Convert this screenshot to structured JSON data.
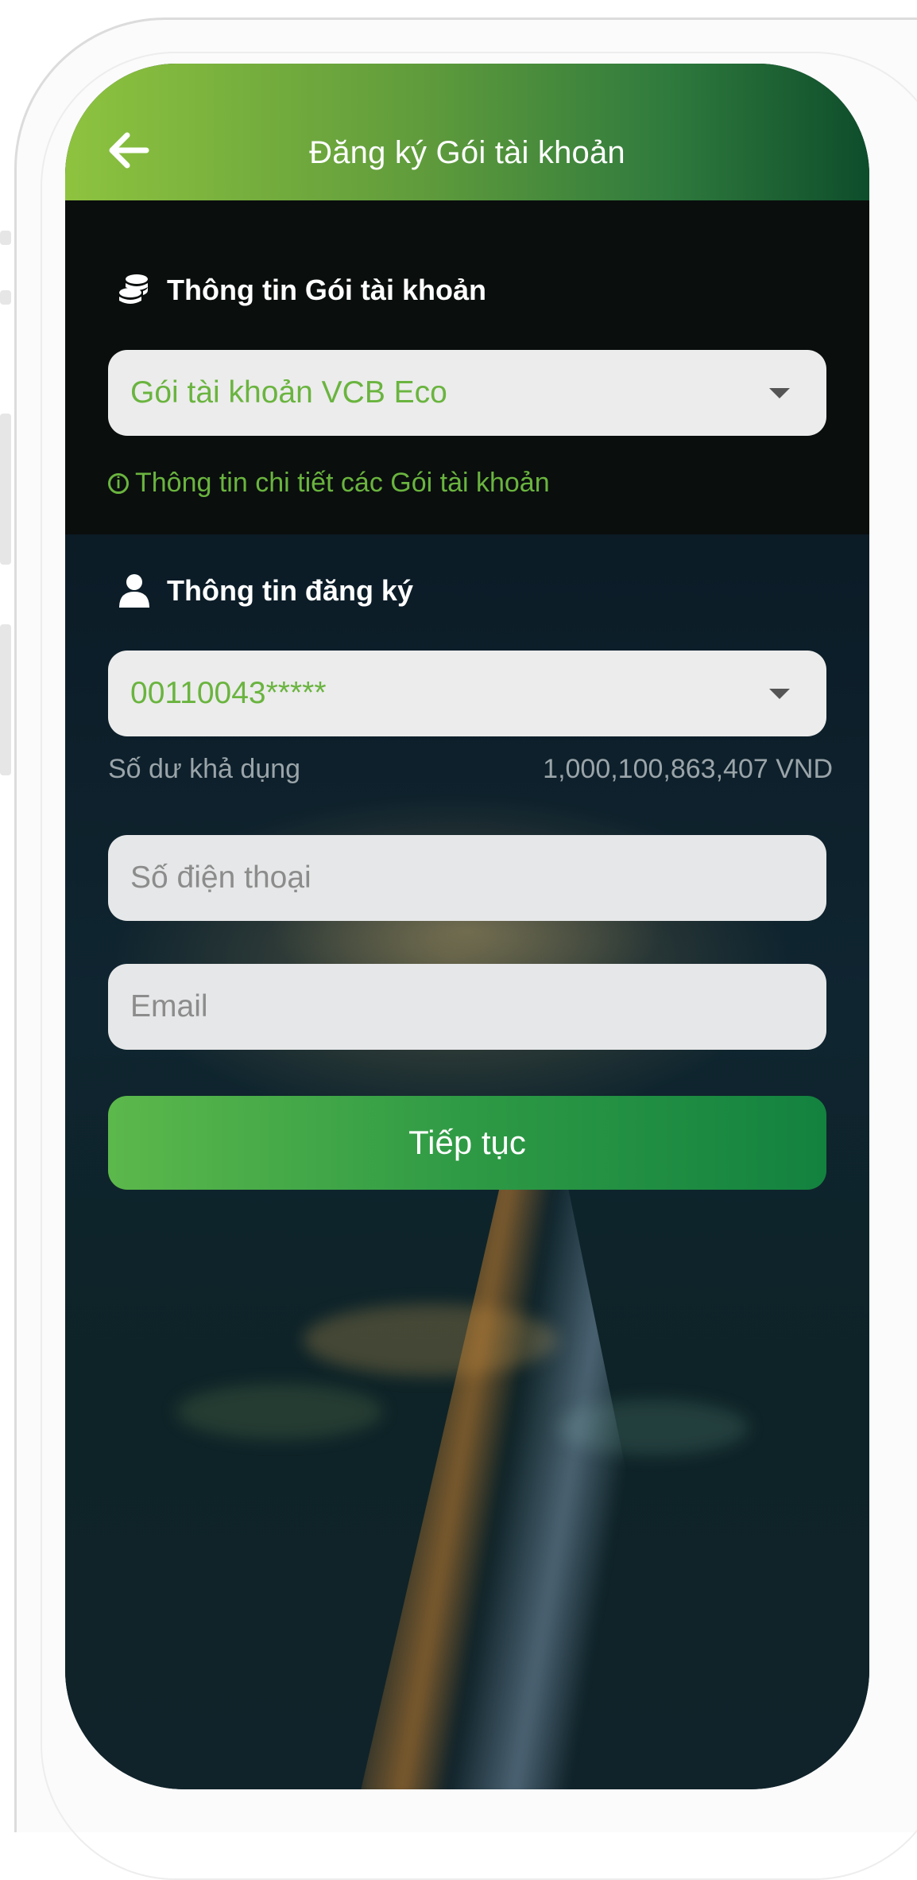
{
  "header": {
    "title": "Đăng ký Gói tài khoản"
  },
  "package_section": {
    "title": "Thông tin Gói tài khoản",
    "selected_package": "Gói tài khoản VCB Eco",
    "detail_link": "Thông tin chi tiết các Gói tài khoản"
  },
  "registration_section": {
    "title": "Thông tin đăng ký",
    "account_number": "00110043*****",
    "balance_label": "Số dư khả dụng",
    "balance_value": "1,000,100,863,407 VND",
    "phone_placeholder": "Số điện thoại",
    "email_placeholder": "Email"
  },
  "actions": {
    "continue_label": "Tiếp tục"
  },
  "colors": {
    "accent_green": "#6ab43f",
    "header_gradient_start": "#8ec33f",
    "header_gradient_end": "#0e4d2b",
    "button_green": "#13823f"
  },
  "icons": {
    "back": "arrow-left-icon",
    "package": "coins-stack-icon",
    "user": "user-icon",
    "info": "info-icon",
    "dropdown": "caret-down-icon"
  }
}
